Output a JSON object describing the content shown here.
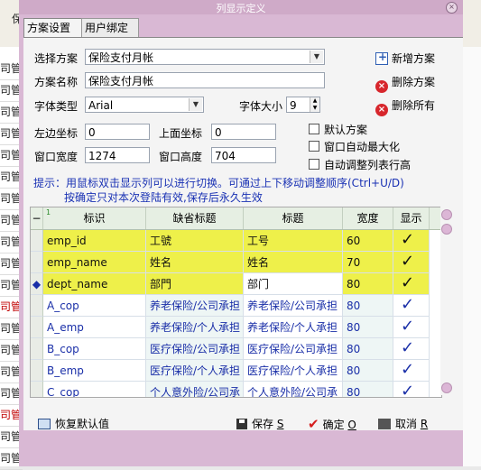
{
  "background": {
    "top_label": "保",
    "left_rows": [
      {
        "text": "司管",
        "red": false
      },
      {
        "text": "司管",
        "red": false
      },
      {
        "text": "司管",
        "red": false
      },
      {
        "text": "司管",
        "red": false
      },
      {
        "text": "司管",
        "red": false
      },
      {
        "text": "司管",
        "red": false
      },
      {
        "text": "司管",
        "red": false
      },
      {
        "text": "司管",
        "red": false
      },
      {
        "text": "司管",
        "red": false
      },
      {
        "text": "司管",
        "red": false
      },
      {
        "text": "司管",
        "red": false
      },
      {
        "text": "司管",
        "red": true
      },
      {
        "text": "司管",
        "red": false
      },
      {
        "text": "司管",
        "red": false
      },
      {
        "text": "司管",
        "red": false
      },
      {
        "text": "司管",
        "red": false
      },
      {
        "text": "司管",
        "red": true
      },
      {
        "text": "司管",
        "red": false
      },
      {
        "text": "司管",
        "red": false
      }
    ]
  },
  "dialog": {
    "title": "列显示定义",
    "close_icon": "×",
    "tabs": [
      {
        "label": "方案设置",
        "active": true
      },
      {
        "label": "用户绑定",
        "active": false
      }
    ]
  },
  "form": {
    "scheme_label": "选择方案",
    "scheme_value": "保险支付月帐",
    "scheme_name_label": "方案名称",
    "scheme_name_value": "保险支付月帐",
    "font_type_label": "字体类型",
    "font_type_value": "Arial",
    "font_size_label": "字体大小",
    "font_size_value": "9",
    "left_label": "左边坐标",
    "left_value": "0",
    "top_label": "上面坐标",
    "top_value": "0",
    "width_label": "窗口宽度",
    "width_value": "1274",
    "height_label": "窗口高度",
    "height_value": "704"
  },
  "actions": {
    "add": "新增方案",
    "delete": "删除方案",
    "delete_all": "删除所有"
  },
  "checkboxes": [
    {
      "label": "默认方案",
      "checked": false
    },
    {
      "label": "窗口自动最大化",
      "checked": false
    },
    {
      "label": "自动调整列表行高",
      "checked": false
    }
  ],
  "tips": {
    "line1": "提示：用鼠标双击显示列可以进行切换。可通过上下移动调整顺序(Ctrl+U/D)",
    "line2": "按确定只对本次登陆有效,保存后永久生效"
  },
  "grid": {
    "header_marker": "−",
    "sort_indicator": "1",
    "columns": [
      "标识",
      "缺省标题",
      "标题",
      "宽度",
      "显示"
    ],
    "check_glyph": "✓",
    "current_marker": "◆",
    "rows": [
      {
        "id": "emp_id",
        "default_title": "工號",
        "title": "工号",
        "width": "60",
        "show": true,
        "highlight": true,
        "current": false
      },
      {
        "id": "emp_name",
        "default_title": "姓名",
        "title": "姓名",
        "width": "70",
        "show": true,
        "highlight": true,
        "current": false
      },
      {
        "id": "dept_name",
        "default_title": "部門",
        "title": "部门",
        "width": "80",
        "show": true,
        "highlight": true,
        "current": true
      },
      {
        "id": "A_cop",
        "default_title": "养老保险/公司承担",
        "title": "养老保险/公司承担",
        "width": "80",
        "show": true,
        "highlight": false,
        "current": false
      },
      {
        "id": "A_emp",
        "default_title": "养老保险/个人承担",
        "title": "养老保险/个人承担",
        "width": "80",
        "show": true,
        "highlight": false,
        "current": false
      },
      {
        "id": "B_cop",
        "default_title": "医疗保险/公司承担",
        "title": "医疗保险/公司承担",
        "width": "80",
        "show": true,
        "highlight": false,
        "current": false
      },
      {
        "id": "B_emp",
        "default_title": "医疗保险/个人承担",
        "title": "医疗保险/个人承担",
        "width": "80",
        "show": true,
        "highlight": false,
        "current": false
      },
      {
        "id": "C_cop",
        "default_title": "个人意外险/公司承",
        "title": "个人意外险/公司承",
        "width": "80",
        "show": true,
        "highlight": false,
        "current": false
      }
    ]
  },
  "buttons": {
    "restore": "恢复默认值",
    "save": "保存",
    "save_key": "S",
    "ok": "确定",
    "ok_key": "O",
    "cancel": "取消",
    "cancel_key": "R"
  }
}
